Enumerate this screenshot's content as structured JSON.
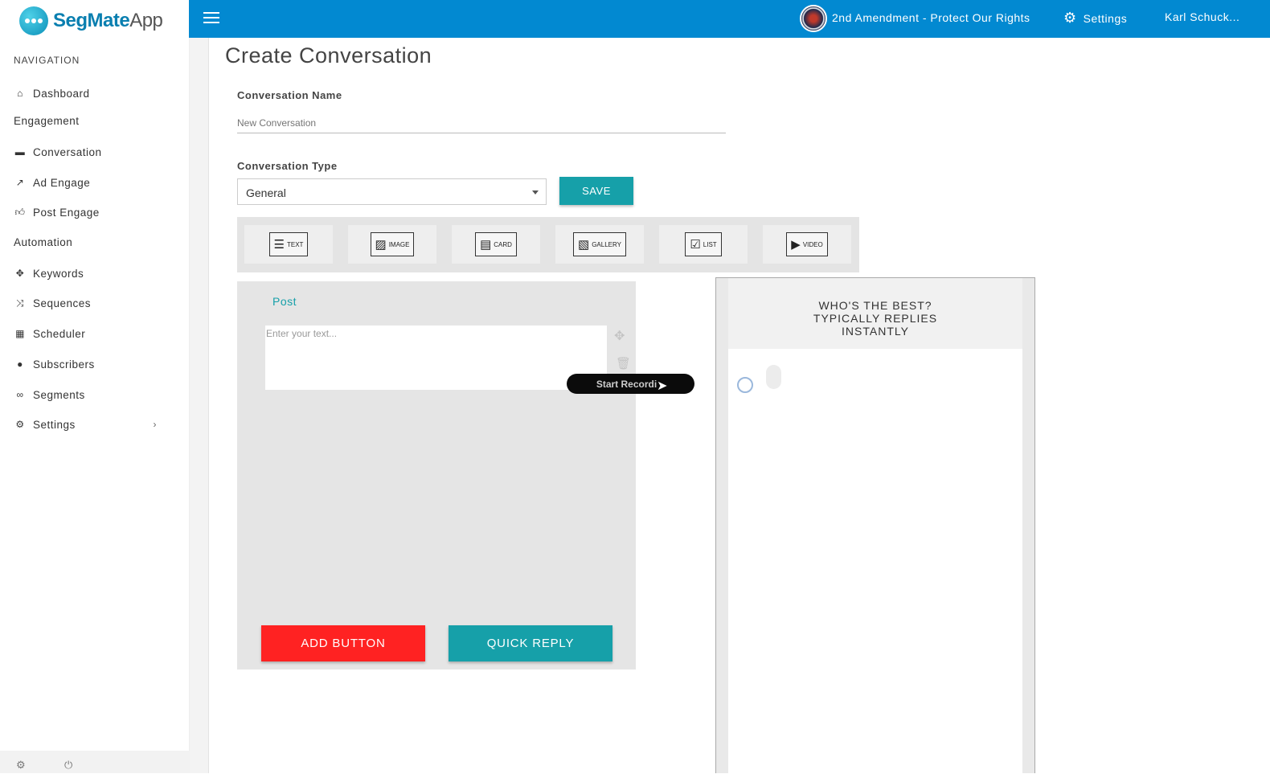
{
  "app": {
    "name_bold": "SegMate",
    "name_light": "App"
  },
  "sidebar": {
    "nav_title": "NAVIGATION",
    "dashboard": "Dashboard",
    "engagement_section": "Engagement",
    "conversation": "Conversation",
    "ad_engage": "Ad Engage",
    "post_engage": "Post Engage",
    "automation_section": "Automation",
    "keywords": "Keywords",
    "sequences": "Sequences",
    "scheduler": "Scheduler",
    "subscribers": "Subscribers",
    "segments": "Segments",
    "settings": "Settings",
    "chevron": "›"
  },
  "topbar": {
    "page_name": "2nd Amendment - Protect Our Rights",
    "settings_label": "Settings",
    "user_name": "Karl Schuck..."
  },
  "main": {
    "title": "Create Conversation",
    "name_label": "Conversation Name",
    "name_placeholder": "New Conversation",
    "type_label": "Conversation Type",
    "type_value": "General",
    "save_label": "SAVE"
  },
  "toolbar": {
    "text": "TEXT",
    "image": "IMAGE",
    "card": "CARD",
    "gallery": "GALLERY",
    "list": "LIST",
    "video": "VIDEO"
  },
  "editor": {
    "post_label": "Post",
    "text_placeholder": "Enter your text...",
    "add_button": "ADD BUTTON",
    "quick_reply": "QUICK REPLY"
  },
  "recording": {
    "label": "Start Recordi"
  },
  "preview": {
    "line1": "WHO'S THE BEST?",
    "line2": "TYPICALLY REPLIES",
    "line3": "INSTANTLY"
  },
  "colors": {
    "primary": "#0289d1",
    "teal": "#16a0a9",
    "red": "#ff2222"
  }
}
